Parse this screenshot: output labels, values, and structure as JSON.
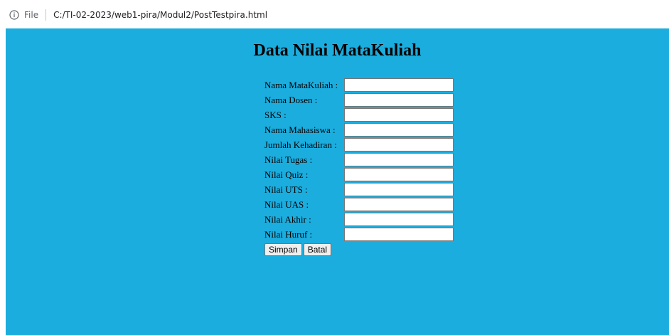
{
  "browser": {
    "file_label": "File",
    "url": "C:/TI-02-2023/web1-pira/Modul2/PostTestpira.html",
    "info_icon": "info-icon"
  },
  "page": {
    "background": "#1badde",
    "title": "Data Nilai MataKuliah"
  },
  "form": {
    "fields": [
      {
        "label": "Nama MataKuliah :",
        "value": ""
      },
      {
        "label": "Nama Dosen :",
        "value": ""
      },
      {
        "label": "SKS :",
        "value": ""
      },
      {
        "label": "Nama Mahasiswa :",
        "value": ""
      },
      {
        "label": "Jumlah Kehadiran :",
        "value": ""
      },
      {
        "label": "Nilai Tugas :",
        "value": ""
      },
      {
        "label": "Nilai Quiz :",
        "value": ""
      },
      {
        "label": "Nilai UTS :",
        "value": ""
      },
      {
        "label": "Nilai UAS :",
        "value": ""
      },
      {
        "label": "Nilai Akhir :",
        "value": ""
      },
      {
        "label": "Nilai Huruf :",
        "value": ""
      }
    ],
    "submit_label": "Simpan",
    "reset_label": "Batal"
  }
}
